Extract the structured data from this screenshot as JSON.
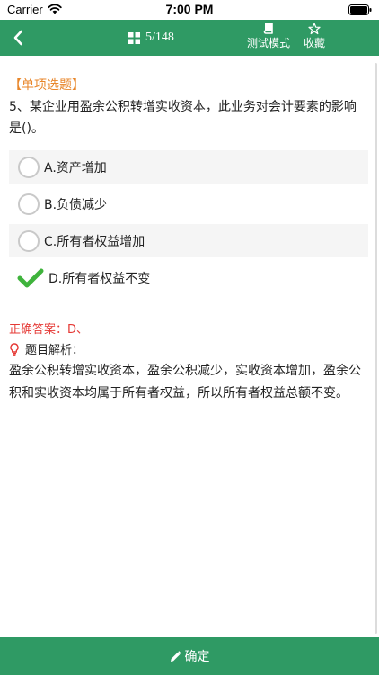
{
  "status_bar": {
    "carrier": "Carrier",
    "time": "7:00 PM"
  },
  "nav": {
    "progress": "5/148",
    "test_mode_label": "测试模式",
    "favorite_label": "收藏",
    "accent_color": "#2f9a64"
  },
  "question": {
    "type_label": "【单项选题】",
    "text": "5、某企业用盈余公积转增实收资本，此业务对会计要素的影响是()。",
    "options": [
      {
        "label": "A.资产增加",
        "state": "unselected"
      },
      {
        "label": "B.负债减少",
        "state": "unselected"
      },
      {
        "label": "C.所有者权益增加",
        "state": "unselected"
      },
      {
        "label": "D.所有者权益不变",
        "state": "correct"
      }
    ]
  },
  "answer": {
    "correct_answer": "正确答案：D、",
    "analysis_title": "题目解析：",
    "analysis_text": "盈余公积转增实收资本，盈余公积减少，实收资本增加，盈余公积和实收资本均属于所有者权益，所以所有者权益总额不变。"
  },
  "footer": {
    "confirm_label": "确定"
  },
  "icons": {
    "back": "chevron-left-icon",
    "grid": "grid-icon",
    "test_mode": "book-icon",
    "favorite": "star-icon",
    "check": "check-icon",
    "analysis": "bulb-icon",
    "confirm": "pencil-icon"
  }
}
